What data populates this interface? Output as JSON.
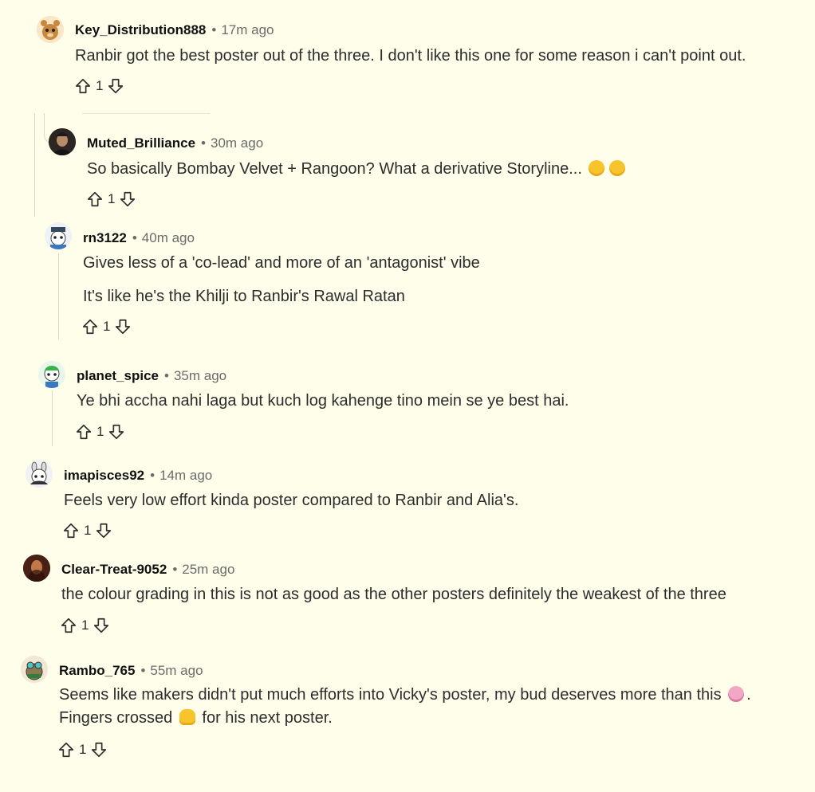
{
  "comments": [
    {
      "author": "Key_Distribution888",
      "time": "17m ago",
      "text": "Ranbir got the best poster out of the three. I don't like this one for some reason i can't point out.",
      "score": "1",
      "avatar": "snoo-bear-avatar"
    },
    {
      "author": "Muted_Brilliance",
      "time": "30m ago",
      "text": "So basically Bombay Velvet + Rangoon? What a derivative Storyline...",
      "emojis": [
        "eye-roll-emoji",
        "raised-eyebrow-emoji"
      ],
      "score": "1",
      "avatar": "photo-avatar"
    },
    {
      "author": "rn3122",
      "time": "40m ago",
      "paragraphs": [
        "Gives less of a 'co-lead' and more of an 'antagonist' vibe",
        "It's like he's the Khilji to Ranbir's Rawal Ratan"
      ],
      "score": "1",
      "avatar": "snoo-hat-avatar"
    },
    {
      "author": "planet_spice",
      "time": "35m ago",
      "text": "Ye bhi accha nahi laga but kuch log kahenge tino mein se ye best hai.",
      "score": "1",
      "avatar": "snoo-green-avatar"
    },
    {
      "author": "imapisces92",
      "time": "14m ago",
      "text": "Feels very low effort kinda poster compared to Ranbir and Alia's.",
      "score": "1",
      "avatar": "snoo-bunny-avatar"
    },
    {
      "author": "Clear-Treat-9052",
      "time": "25m ago",
      "text": "the colour grading in this is not as good as the other posters definitely the weakest of the three",
      "score": "1",
      "avatar": "photo-avatar"
    },
    {
      "author": "Rambo_765",
      "time": "55m ago",
      "line1": "Seems like makers didn't put much efforts into Vicky's poster, my bud deserves more than this",
      "line1_end": ".",
      "line2_start": "Fingers crossed",
      "line2_end": "for his next poster.",
      "emojis": [
        "loudly-crying-emoji",
        "crossed-fingers-emoji"
      ],
      "score": "1",
      "avatar": "snoo-goggles-avatar"
    }
  ]
}
